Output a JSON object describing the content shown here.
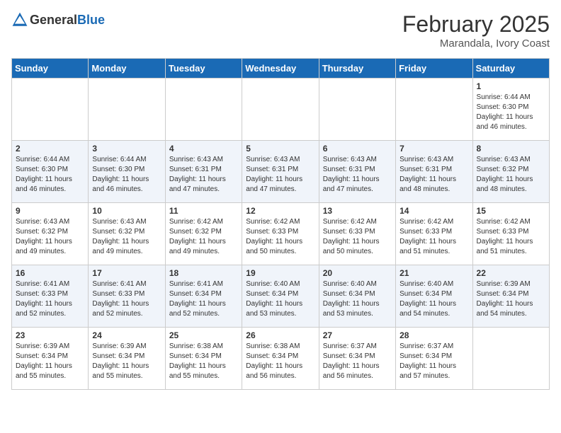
{
  "header": {
    "logo_general": "General",
    "logo_blue": "Blue",
    "month_year": "February 2025",
    "location": "Marandala, Ivory Coast"
  },
  "weekdays": [
    "Sunday",
    "Monday",
    "Tuesday",
    "Wednesday",
    "Thursday",
    "Friday",
    "Saturday"
  ],
  "weeks": [
    [
      {
        "day": "",
        "info": ""
      },
      {
        "day": "",
        "info": ""
      },
      {
        "day": "",
        "info": ""
      },
      {
        "day": "",
        "info": ""
      },
      {
        "day": "",
        "info": ""
      },
      {
        "day": "",
        "info": ""
      },
      {
        "day": "1",
        "info": "Sunrise: 6:44 AM\nSunset: 6:30 PM\nDaylight: 11 hours and 46 minutes."
      }
    ],
    [
      {
        "day": "2",
        "info": "Sunrise: 6:44 AM\nSunset: 6:30 PM\nDaylight: 11 hours and 46 minutes."
      },
      {
        "day": "3",
        "info": "Sunrise: 6:44 AM\nSunset: 6:30 PM\nDaylight: 11 hours and 46 minutes."
      },
      {
        "day": "4",
        "info": "Sunrise: 6:43 AM\nSunset: 6:31 PM\nDaylight: 11 hours and 47 minutes."
      },
      {
        "day": "5",
        "info": "Sunrise: 6:43 AM\nSunset: 6:31 PM\nDaylight: 11 hours and 47 minutes."
      },
      {
        "day": "6",
        "info": "Sunrise: 6:43 AM\nSunset: 6:31 PM\nDaylight: 11 hours and 47 minutes."
      },
      {
        "day": "7",
        "info": "Sunrise: 6:43 AM\nSunset: 6:31 PM\nDaylight: 11 hours and 48 minutes."
      },
      {
        "day": "8",
        "info": "Sunrise: 6:43 AM\nSunset: 6:32 PM\nDaylight: 11 hours and 48 minutes."
      }
    ],
    [
      {
        "day": "9",
        "info": "Sunrise: 6:43 AM\nSunset: 6:32 PM\nDaylight: 11 hours and 49 minutes."
      },
      {
        "day": "10",
        "info": "Sunrise: 6:43 AM\nSunset: 6:32 PM\nDaylight: 11 hours and 49 minutes."
      },
      {
        "day": "11",
        "info": "Sunrise: 6:42 AM\nSunset: 6:32 PM\nDaylight: 11 hours and 49 minutes."
      },
      {
        "day": "12",
        "info": "Sunrise: 6:42 AM\nSunset: 6:33 PM\nDaylight: 11 hours and 50 minutes."
      },
      {
        "day": "13",
        "info": "Sunrise: 6:42 AM\nSunset: 6:33 PM\nDaylight: 11 hours and 50 minutes."
      },
      {
        "day": "14",
        "info": "Sunrise: 6:42 AM\nSunset: 6:33 PM\nDaylight: 11 hours and 51 minutes."
      },
      {
        "day": "15",
        "info": "Sunrise: 6:42 AM\nSunset: 6:33 PM\nDaylight: 11 hours and 51 minutes."
      }
    ],
    [
      {
        "day": "16",
        "info": "Sunrise: 6:41 AM\nSunset: 6:33 PM\nDaylight: 11 hours and 52 minutes."
      },
      {
        "day": "17",
        "info": "Sunrise: 6:41 AM\nSunset: 6:33 PM\nDaylight: 11 hours and 52 minutes."
      },
      {
        "day": "18",
        "info": "Sunrise: 6:41 AM\nSunset: 6:34 PM\nDaylight: 11 hours and 52 minutes."
      },
      {
        "day": "19",
        "info": "Sunrise: 6:40 AM\nSunset: 6:34 PM\nDaylight: 11 hours and 53 minutes."
      },
      {
        "day": "20",
        "info": "Sunrise: 6:40 AM\nSunset: 6:34 PM\nDaylight: 11 hours and 53 minutes."
      },
      {
        "day": "21",
        "info": "Sunrise: 6:40 AM\nSunset: 6:34 PM\nDaylight: 11 hours and 54 minutes."
      },
      {
        "day": "22",
        "info": "Sunrise: 6:39 AM\nSunset: 6:34 PM\nDaylight: 11 hours and 54 minutes."
      }
    ],
    [
      {
        "day": "23",
        "info": "Sunrise: 6:39 AM\nSunset: 6:34 PM\nDaylight: 11 hours and 55 minutes."
      },
      {
        "day": "24",
        "info": "Sunrise: 6:39 AM\nSunset: 6:34 PM\nDaylight: 11 hours and 55 minutes."
      },
      {
        "day": "25",
        "info": "Sunrise: 6:38 AM\nSunset: 6:34 PM\nDaylight: 11 hours and 55 minutes."
      },
      {
        "day": "26",
        "info": "Sunrise: 6:38 AM\nSunset: 6:34 PM\nDaylight: 11 hours and 56 minutes."
      },
      {
        "day": "27",
        "info": "Sunrise: 6:37 AM\nSunset: 6:34 PM\nDaylight: 11 hours and 56 minutes."
      },
      {
        "day": "28",
        "info": "Sunrise: 6:37 AM\nSunset: 6:34 PM\nDaylight: 11 hours and 57 minutes."
      },
      {
        "day": "",
        "info": ""
      }
    ]
  ]
}
